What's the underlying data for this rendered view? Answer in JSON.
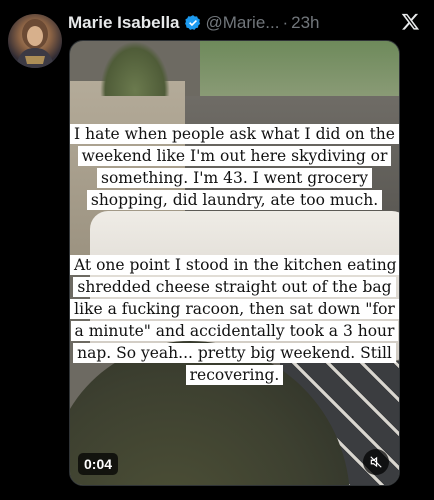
{
  "post": {
    "display_name": "Marie Isabella",
    "handle": "@Marie...",
    "separator": "·",
    "time": "23h"
  },
  "icons": {
    "verified": "verified-badge-icon",
    "logo": "x-logo-icon",
    "mute": "speaker-muted-icon"
  },
  "colors": {
    "verified": "#1d9bf0",
    "secondary_text": "#71767b",
    "background": "#000000"
  },
  "media": {
    "caption_1": "I hate when people ask what I did on the weekend like I'm out here skydiving or something. I'm 43. I went grocery shopping, did laundry, ate too much.",
    "caption_2": "At one point I stood in the kitchen eating shredded cheese straight out of the bag like a fucking racoon, then sat down \"for a minute\" and accidentally took a 3 hour nap. So yeah... pretty big weekend. Still recovering.",
    "duration": "0:04"
  }
}
